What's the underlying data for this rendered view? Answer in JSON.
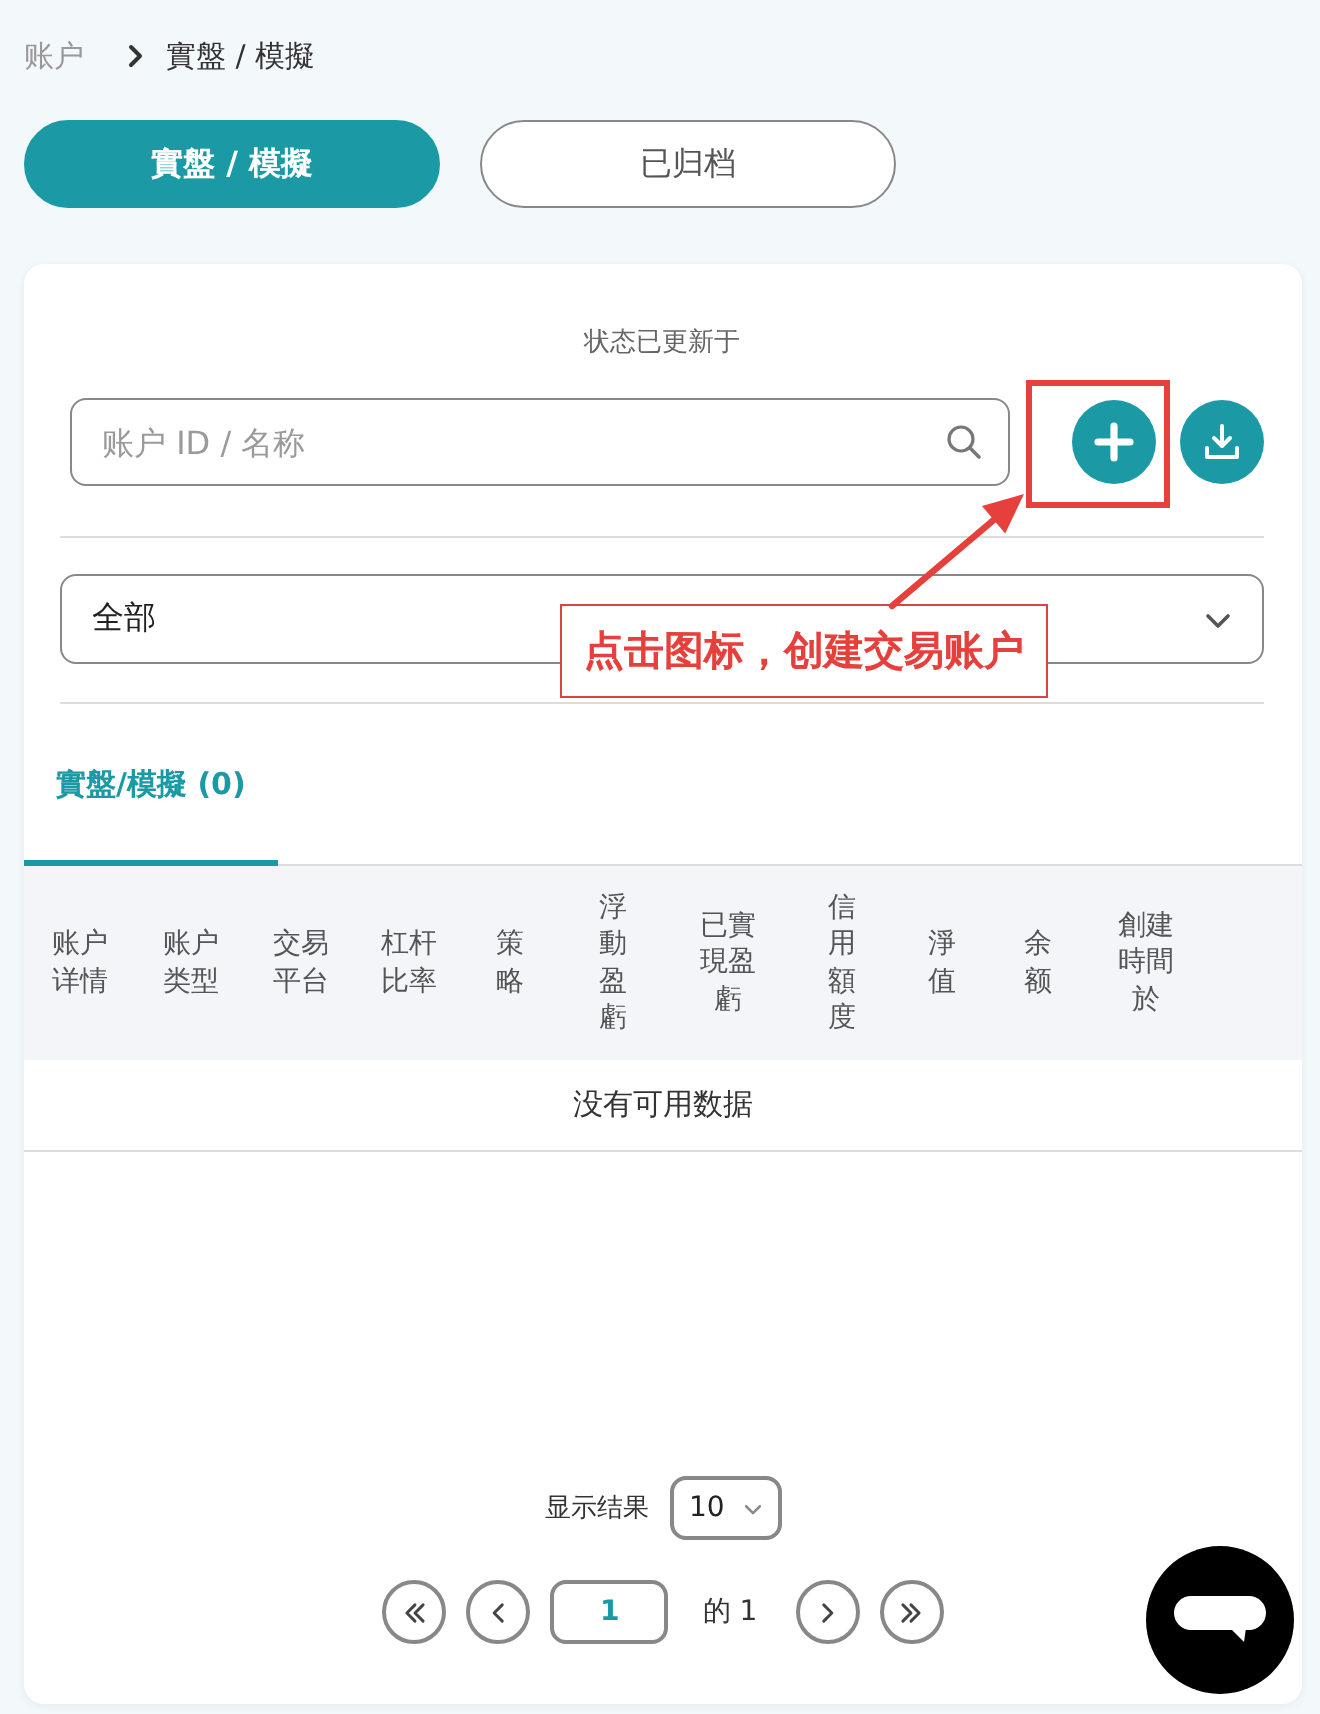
{
  "breadcrumb": [
    {
      "label": "账户",
      "current": false
    },
    {
      "label": "實盤 / 模擬",
      "current": true
    }
  ],
  "view_tabs": [
    {
      "label": "實盤 / 模擬",
      "selected": true
    },
    {
      "label": "已归档",
      "selected": false
    }
  ],
  "status_text": "状态已更新于",
  "search": {
    "placeholder": "账户 ID / 名称"
  },
  "toolbar_buttons": [
    {
      "kind": "add",
      "highlighted": true
    },
    {
      "kind": "download",
      "highlighted": false
    }
  ],
  "filter": {
    "value": "全部"
  },
  "annotation": {
    "text": "点击图标，创建交易账户"
  },
  "list_tabs": [
    {
      "label": "實盤/模擬 (0)",
      "selected": true
    }
  ],
  "table": {
    "columns": [
      "账户详情",
      "账户类型",
      "交易平台",
      "杠杆比率",
      "策略",
      "浮動盈虧",
      "已實現盈虧",
      "信用額度",
      "淨值",
      "余额",
      "創建時間於"
    ],
    "empty_message": "没有可用数据"
  },
  "pagination": {
    "page_size_label": "显示结果",
    "page_size": "10",
    "page": "1",
    "total_label": "的 1"
  }
}
